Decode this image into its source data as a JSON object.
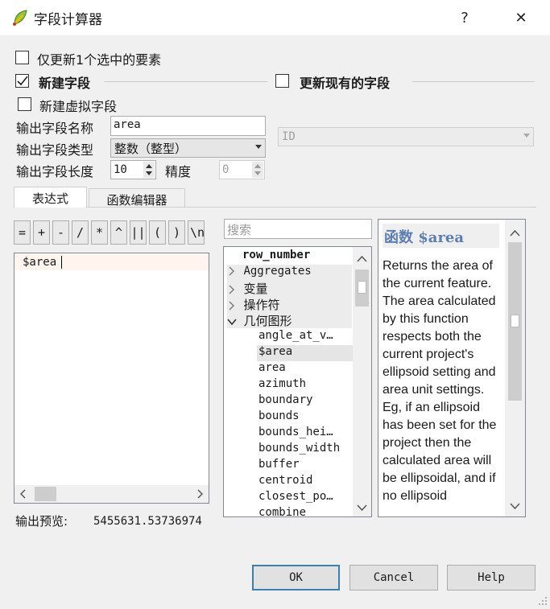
{
  "window": {
    "title": "字段计算器",
    "help": "?",
    "close": "✕"
  },
  "options": {
    "update_selected": "仅更新1个选中的要素",
    "create_field": "新建字段",
    "update_existing": "更新现有的字段",
    "virtual_field": "新建虚拟字段"
  },
  "form": {
    "name_label": "输出字段名称",
    "name_value": "area",
    "type_label": "输出字段类型",
    "type_value": "整数（整型）",
    "length_label": "输出字段长度",
    "length_value": "10",
    "precision_label": "精度",
    "precision_value": "0",
    "existing_field_value": "ID"
  },
  "tabs": [
    "表达式",
    "函数编辑器"
  ],
  "operators": [
    "=",
    "+",
    "-",
    "/",
    "*",
    "^",
    "||",
    "(",
    ")",
    "\\n"
  ],
  "expression": "$area",
  "search_placeholder": "搜索",
  "tree": {
    "header": "row_number",
    "groups": [
      "Aggregates",
      "变量",
      "操作符",
      "几何图形"
    ],
    "items": [
      "angle_at_v…",
      "$area",
      "area",
      "azimuth",
      "boundary",
      "bounds",
      "bounds_hei…",
      "bounds_width",
      "buffer",
      "centroid",
      "closest_po…",
      "combine"
    ]
  },
  "help": {
    "title": "函数 $area",
    "body": "Returns the area of the current feature. The area calculated by this function respects both the current project's ellipsoid setting and area unit settings. Eg, if an ellipsoid has been set for the project then the calculated area will be ellipsoidal, and if no ellipsoid"
  },
  "preview": {
    "label": "输出预览:",
    "value": "5455631.53736974"
  },
  "buttons": {
    "ok": "OK",
    "cancel": "Cancel",
    "help": "Help"
  },
  "colors": {
    "accent": "#3c7fb1",
    "help_title": "#5b7fb3",
    "selection": "#e5e5e5"
  }
}
